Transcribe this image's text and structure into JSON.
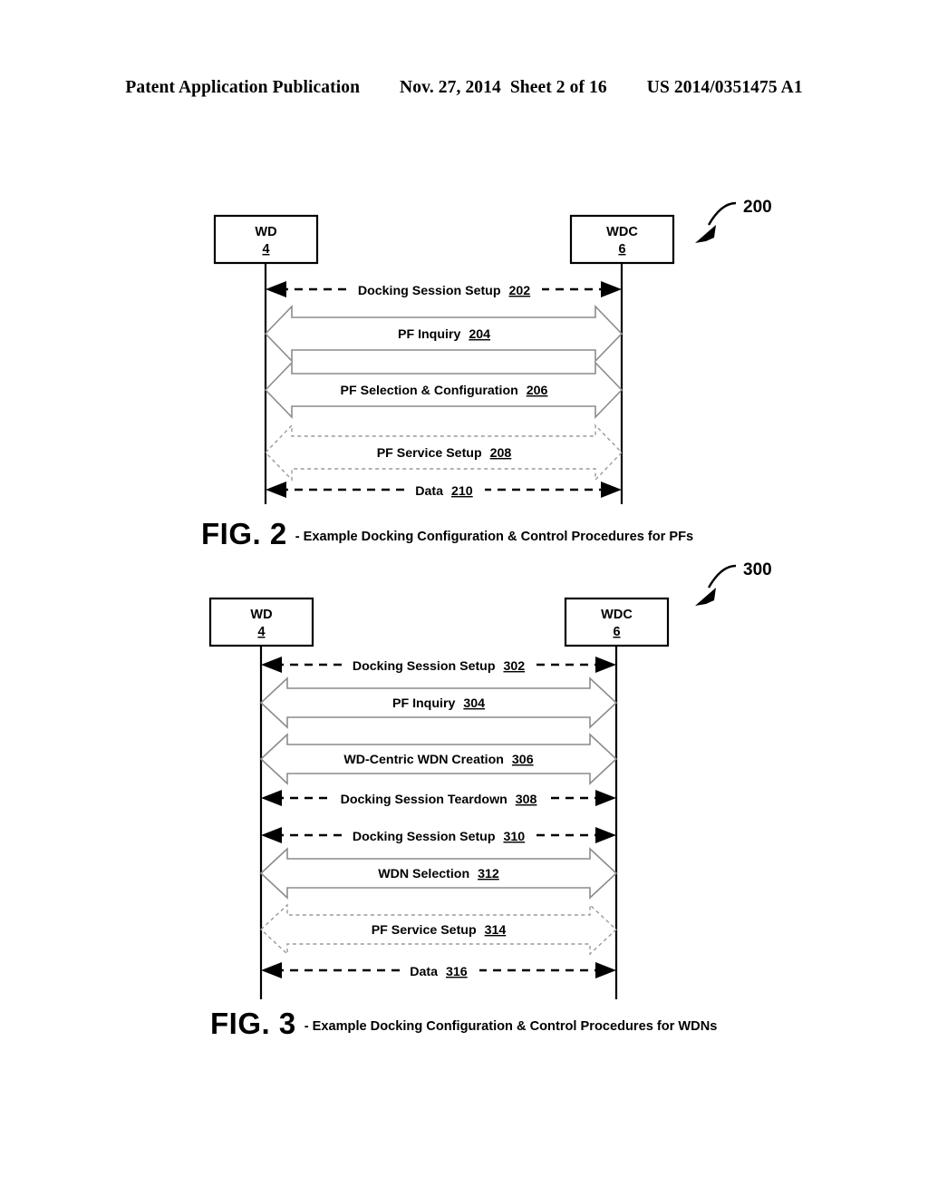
{
  "header": {
    "publication": "Patent Application Publication",
    "date": "Nov. 27, 2014",
    "sheet": "Sheet 2 of 16",
    "patent_number": "US 2014/0351475 A1"
  },
  "figures": [
    {
      "id": "fig-2",
      "callout": "200",
      "caption_number": "FIG. 2",
      "caption_text": "- Example Docking Configuration & Control Procedures for PFs",
      "left_node": {
        "name": "WD",
        "ref": "4"
      },
      "right_node": {
        "name": "WDC",
        "ref": "6"
      },
      "messages": [
        {
          "label": "Docking Session Setup",
          "ref": "202",
          "style": "dashed-line",
          "direction": "bidirectional"
        },
        {
          "label": "PF Inquiry",
          "ref": "204",
          "style": "block-arrow-solid",
          "direction": "bidirectional"
        },
        {
          "label": "PF Selection & Configuration",
          "ref": "206",
          "style": "block-arrow-solid",
          "direction": "bidirectional"
        },
        {
          "label": "PF Service Setup",
          "ref": "208",
          "style": "block-arrow-dashed",
          "direction": "bidirectional"
        },
        {
          "label": "Data",
          "ref": "210",
          "style": "dashed-line",
          "direction": "bidirectional"
        }
      ]
    },
    {
      "id": "fig-3",
      "callout": "300",
      "caption_number": "FIG. 3",
      "caption_text": "- Example Docking Configuration & Control Procedures for WDNs",
      "left_node": {
        "name": "WD",
        "ref": "4"
      },
      "right_node": {
        "name": "WDC",
        "ref": "6"
      },
      "messages": [
        {
          "label": "Docking Session Setup",
          "ref": "302",
          "style": "dashed-line",
          "direction": "bidirectional"
        },
        {
          "label": "PF Inquiry",
          "ref": "304",
          "style": "block-arrow-solid",
          "direction": "bidirectional"
        },
        {
          "label": "WD-Centric WDN Creation",
          "ref": "306",
          "style": "block-arrow-solid",
          "direction": "bidirectional"
        },
        {
          "label": "Docking Session Teardown",
          "ref": "308",
          "style": "dashed-line",
          "direction": "bidirectional"
        },
        {
          "label": "Docking Session Setup",
          "ref": "310",
          "style": "dashed-line",
          "direction": "bidirectional"
        },
        {
          "label": "WDN Selection",
          "ref": "312",
          "style": "block-arrow-solid",
          "direction": "bidirectional"
        },
        {
          "label": "PF Service Setup",
          "ref": "314",
          "style": "block-arrow-dashed",
          "direction": "bidirectional"
        },
        {
          "label": "Data",
          "ref": "316",
          "style": "dashed-line",
          "direction": "bidirectional"
        }
      ]
    }
  ]
}
